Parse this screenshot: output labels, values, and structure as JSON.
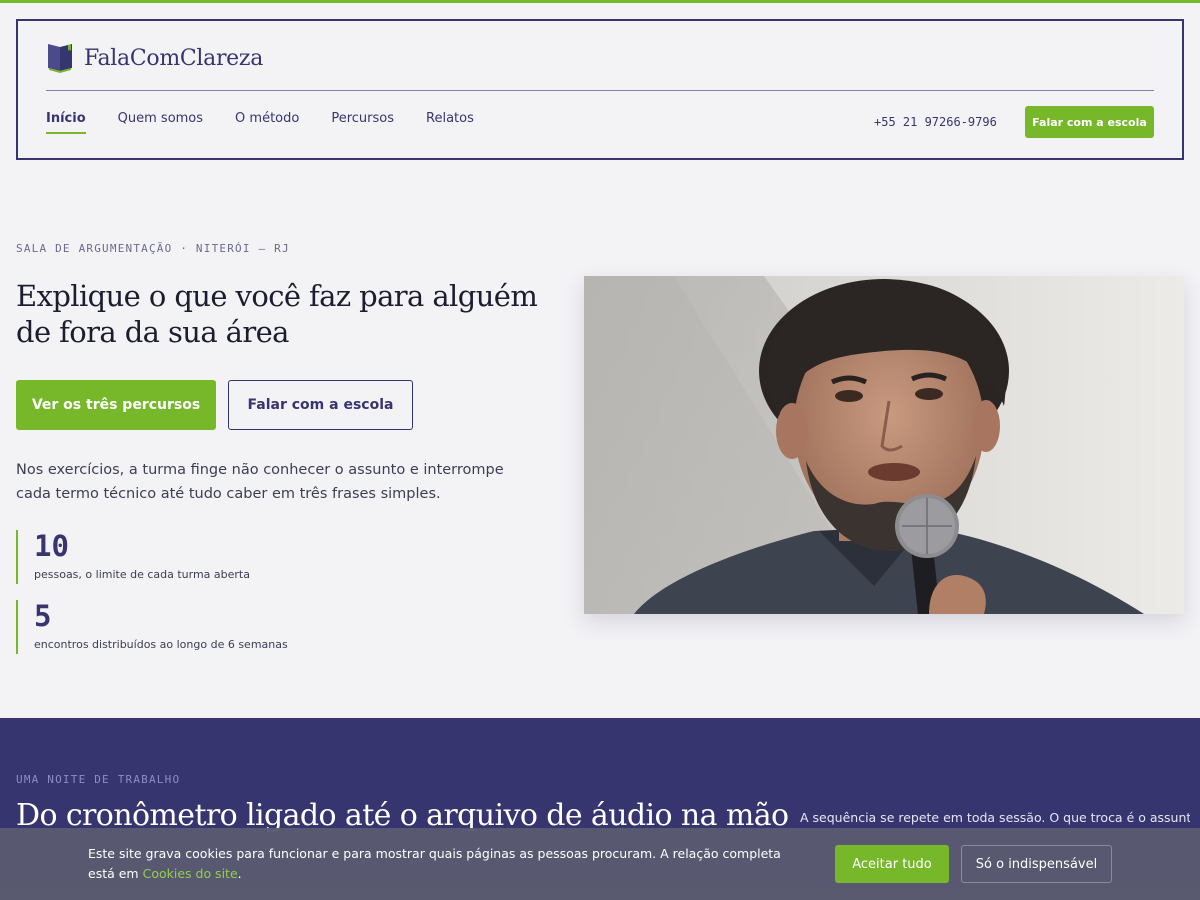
{
  "brand": {
    "name": "FalaComClareza",
    "icon": "book-icon"
  },
  "nav": {
    "items": [
      {
        "label": "Início",
        "active": true
      },
      {
        "label": "Quem somos",
        "active": false
      },
      {
        "label": "O método",
        "active": false
      },
      {
        "label": "Percursos",
        "active": false
      },
      {
        "label": "Relatos",
        "active": false
      }
    ],
    "phone": "+55 21 97266-9796",
    "cta_label": "Falar com a escola"
  },
  "hero": {
    "eyebrow": "SALA DE ARGUMENTAÇÃO · NITERÓI — RJ",
    "title": "Explique o que você faz para alguém de fora da sua área",
    "primary_button": "Ver os três percursos",
    "secondary_button": "Falar com a escola",
    "text": "Nos exercícios, a turma finge não conhecer o assunto e interrompe cada termo técnico até tudo caber em três frases simples.",
    "stats": [
      {
        "value": "10",
        "label": "pessoas, o limite de cada turma aberta"
      },
      {
        "value": "5",
        "label": "encontros distribuídos ao longo de 6 semanas"
      }
    ]
  },
  "band": {
    "eyebrow": "UMA NOITE DE TRABALHO",
    "title": "Do cronômetro ligado até o arquivo de áudio na mão",
    "text": "A sequência se repete em toda sessão. O que troca é o assunto"
  },
  "cookie": {
    "text": "Este site grava cookies para funcionar e para mostrar quais páginas as pessoas procuram. A relação completa está em",
    "link": "Cookies do site",
    "accept": "Aceitar tudo",
    "essential": "Só o indispensável"
  },
  "colors": {
    "accent": "#76b82a",
    "brand": "#37356f",
    "background": "#f3f3f6"
  }
}
